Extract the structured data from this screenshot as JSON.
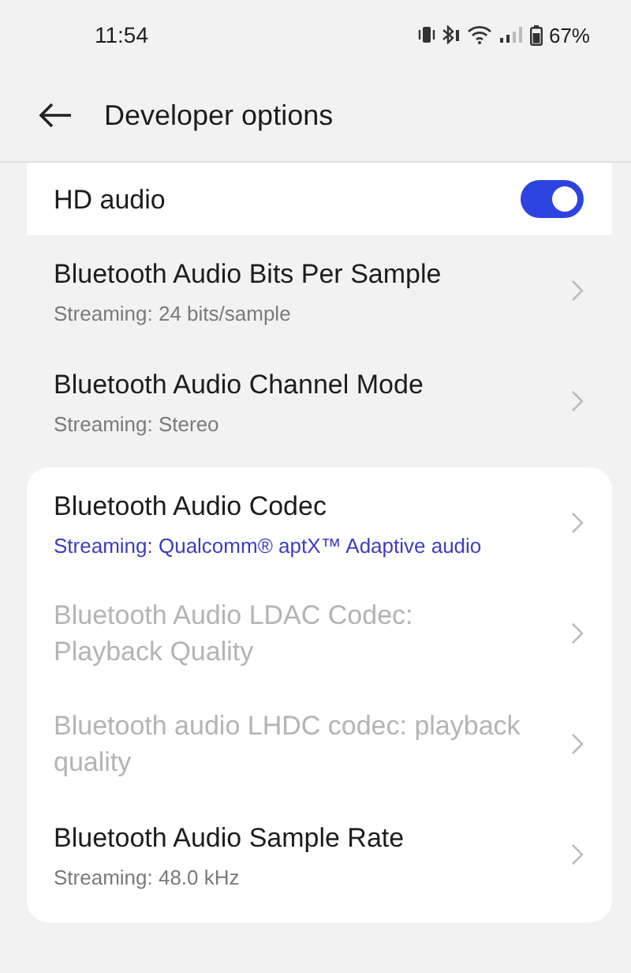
{
  "status_bar": {
    "time": "11:54",
    "battery": "67%"
  },
  "app_bar": {
    "title": "Developer options"
  },
  "groups": [
    {
      "kind": "card",
      "items": [
        {
          "kind": "toggle",
          "title": "HD audio",
          "on": true
        }
      ]
    },
    {
      "kind": "plain",
      "items": [
        {
          "kind": "link",
          "title": "Bluetooth Audio Bits Per Sample",
          "summary": "Streaming: 24 bits/sample",
          "accent": false,
          "disabled": false
        },
        {
          "kind": "link",
          "title": "Bluetooth Audio Channel Mode",
          "summary": "Streaming: Stereo",
          "accent": false,
          "disabled": false
        }
      ]
    },
    {
      "kind": "card",
      "items": [
        {
          "kind": "link",
          "title": "Bluetooth Audio Codec",
          "summary": "Streaming: Qualcomm® aptX™ Adaptive audio",
          "accent": true,
          "disabled": false
        },
        {
          "kind": "link",
          "title": "Bluetooth Audio LDAC Codec: Playback Quality",
          "disabled": true
        },
        {
          "kind": "link",
          "title": "Bluetooth audio LHDC codec: playback quality",
          "disabled": true
        },
        {
          "kind": "link",
          "title": "Bluetooth Audio Sample Rate",
          "summary": "Streaming: 48.0 kHz",
          "accent": false,
          "disabled": false
        }
      ]
    }
  ]
}
